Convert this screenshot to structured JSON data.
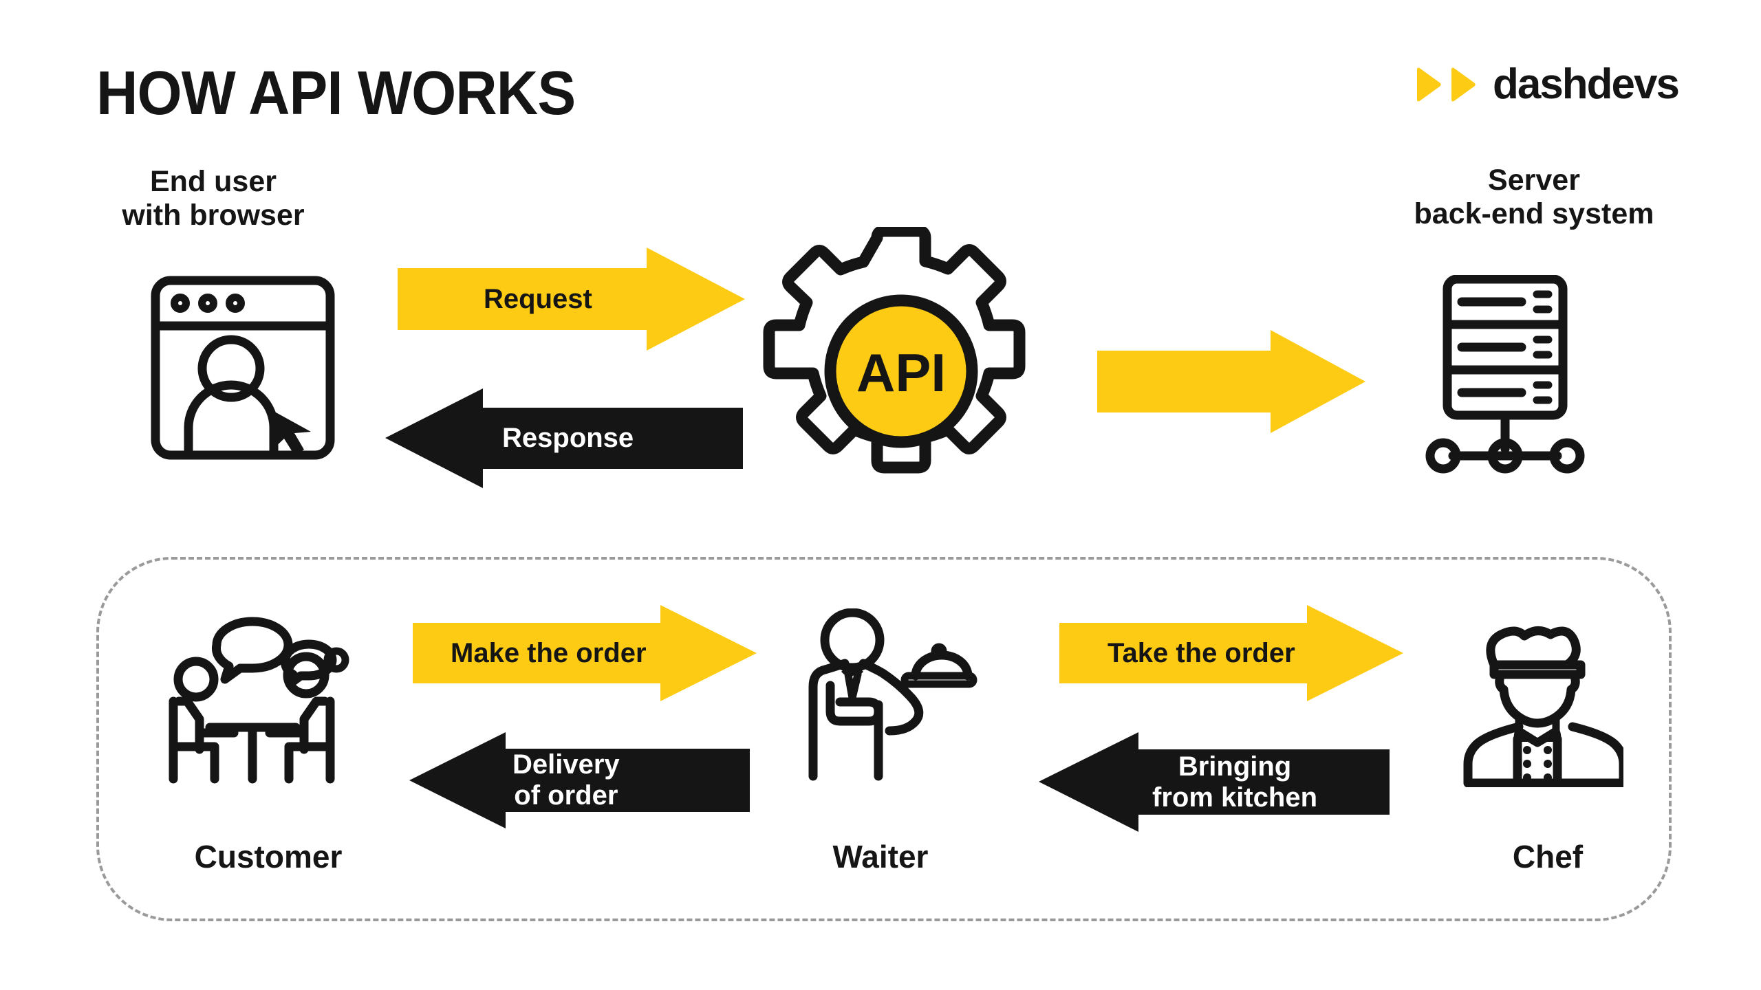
{
  "header": {
    "title": "HOW API WORKS",
    "logo_word": "dashdevs",
    "logo_icon": "double-play-triangle-icon"
  },
  "colors": {
    "yellow": "#FDCB14",
    "black": "#151515",
    "white": "#FFFFFF",
    "dashed_border": "#9A9A9A",
    "background": "#FFFFFF"
  },
  "technical_flow": {
    "nodes": [
      {
        "id": "end-user",
        "label": "End user\nwith browser",
        "icon": "browser-window-with-user-icon"
      },
      {
        "id": "api",
        "label": "API",
        "icon": "gear-icon"
      },
      {
        "id": "server",
        "label": "Server\nback-end system",
        "icon": "server-rack-icon"
      }
    ],
    "arrows": [
      {
        "id": "request",
        "label": "Request",
        "direction": "right",
        "color": "yellow",
        "text_color": "black"
      },
      {
        "id": "response",
        "label": "Response",
        "direction": "left",
        "color": "black",
        "text_color": "white"
      },
      {
        "id": "api-to-server",
        "label": "",
        "direction": "right",
        "color": "yellow",
        "text_color": "black"
      }
    ]
  },
  "restaurant_analogy": {
    "nodes": [
      {
        "id": "customer",
        "label": "Customer",
        "icon": "two-people-at-table-talking-icon"
      },
      {
        "id": "waiter",
        "label": "Waiter",
        "icon": "waiter-with-tray-icon"
      },
      {
        "id": "chef",
        "label": "Chef",
        "icon": "chef-with-toque-icon"
      }
    ],
    "arrows": [
      {
        "id": "make-the-order",
        "label": "Make the order",
        "direction": "right",
        "color": "yellow",
        "text_color": "black"
      },
      {
        "id": "delivery-of-order",
        "label": "Delivery\nof order",
        "direction": "left",
        "color": "black",
        "text_color": "white"
      },
      {
        "id": "take-the-order",
        "label": "Take the order",
        "direction": "right",
        "color": "yellow",
        "text_color": "black"
      },
      {
        "id": "bringing-from-kitchen",
        "label": "Bringing\nfrom kitchen",
        "direction": "left",
        "color": "black",
        "text_color": "white"
      }
    ]
  }
}
